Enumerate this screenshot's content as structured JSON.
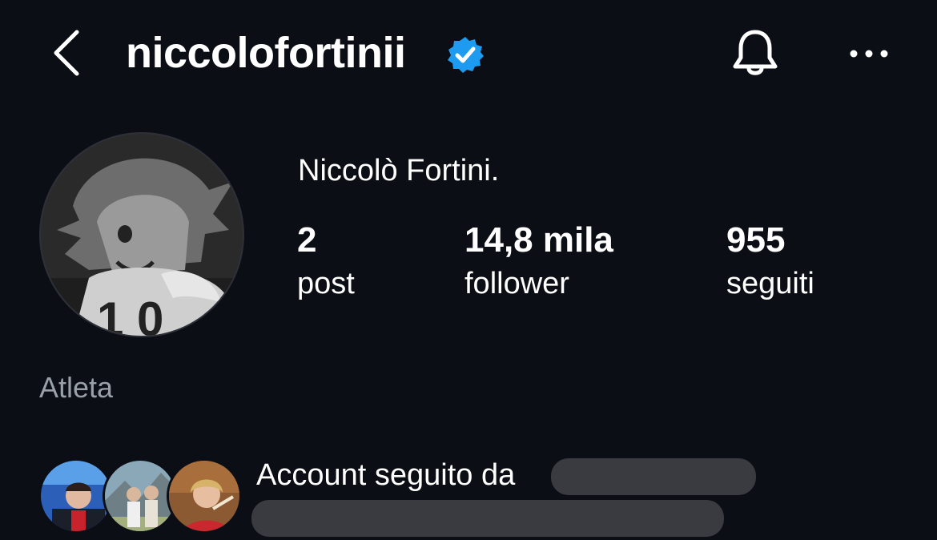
{
  "header": {
    "username": "niccolofortinii",
    "verified_icon": "verified-badge-icon",
    "back_icon": "chevron-left-icon",
    "notifications_icon": "bell-icon",
    "more_icon": "more-horizontal-icon",
    "accent_color": "#1d9bf0"
  },
  "profile": {
    "display_name": "Niccolò Fortini.",
    "category": "Atleta",
    "stats": {
      "posts": {
        "value": "2",
        "label": "post"
      },
      "followers": {
        "value": "14,8 mila",
        "label": "follower"
      },
      "following": {
        "value": "955",
        "label": "seguiti"
      }
    }
  },
  "mutuals": {
    "text": "Account seguito da"
  }
}
